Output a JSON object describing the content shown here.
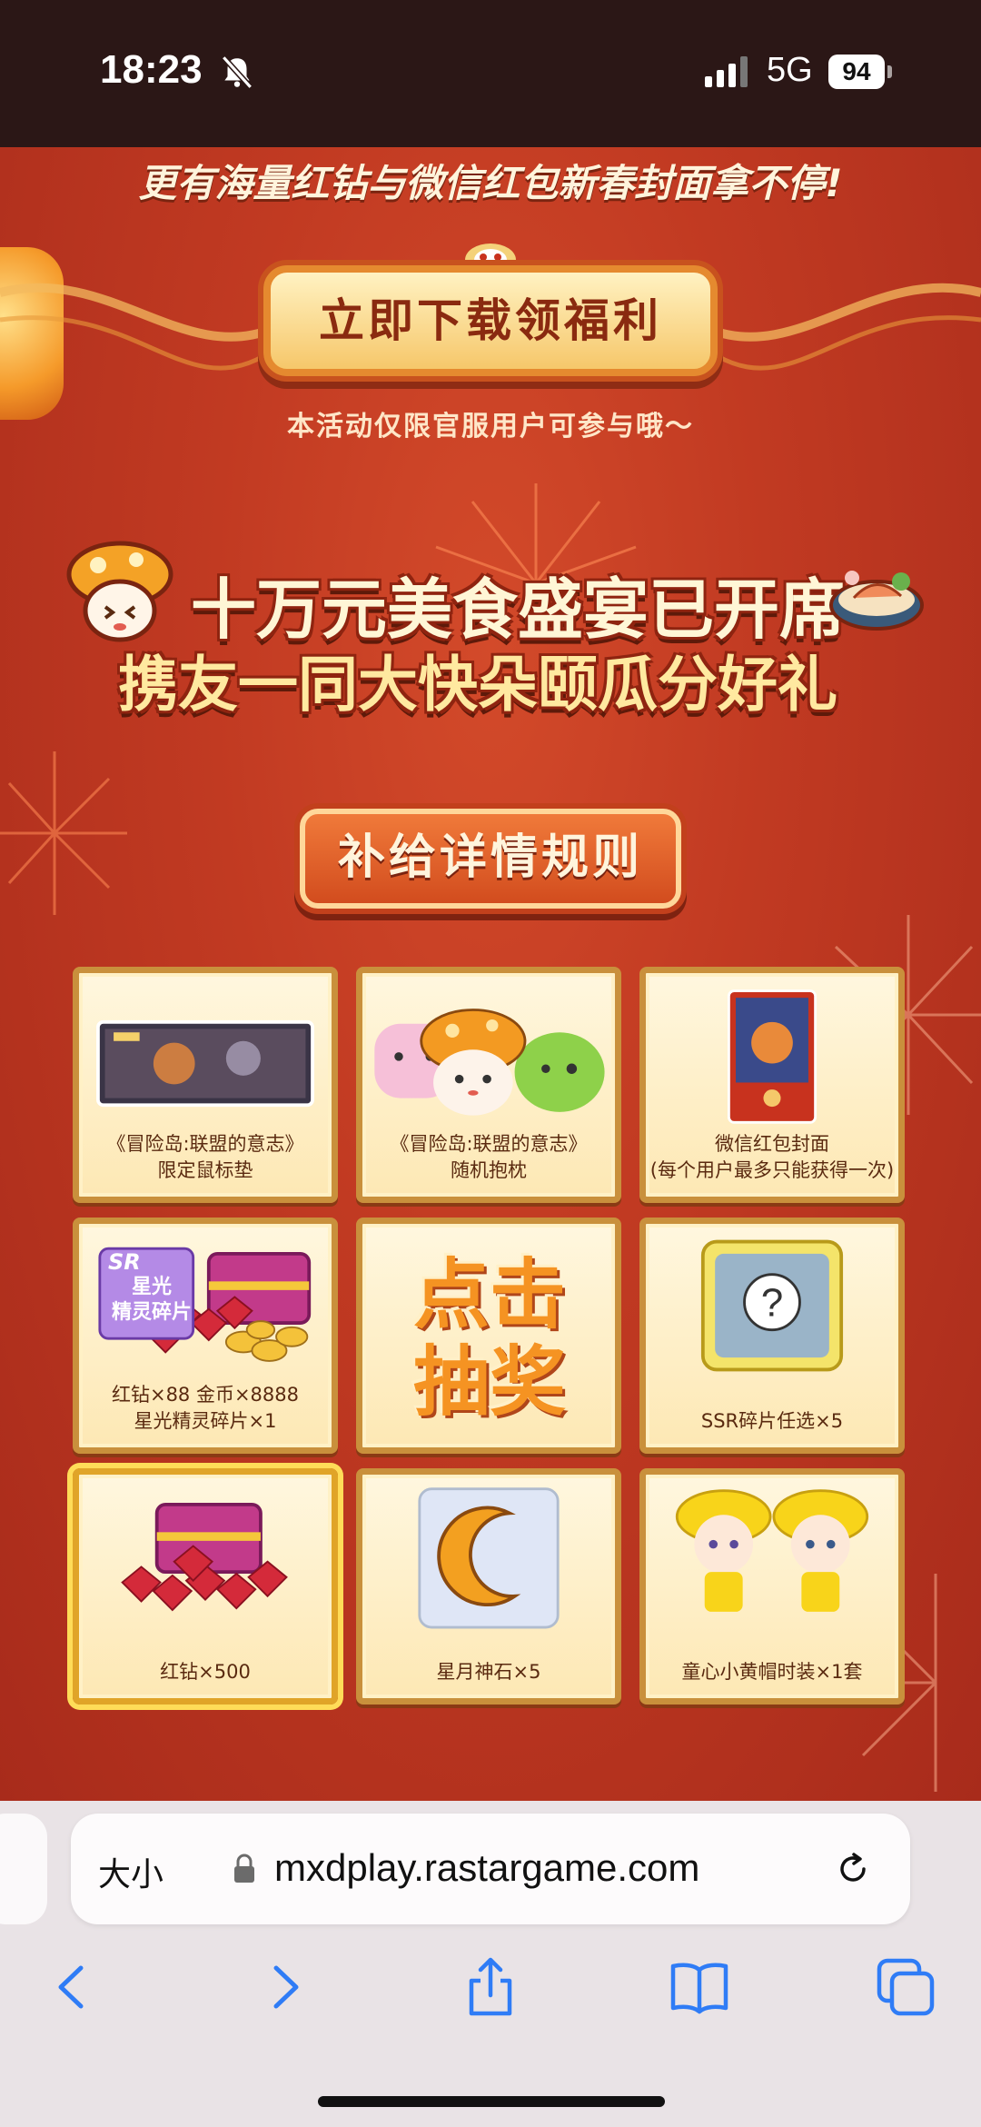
{
  "status_bar": {
    "time": "18:23",
    "network": "5G",
    "battery": "94"
  },
  "page": {
    "promo_text": "更有海量红钻与微信红包新春封面拿不停!",
    "download_button": "立即下载领福利",
    "notice": "本活动仅限官服用户可参与哦～",
    "headline_line1": "十万元美食盛宴已开席",
    "headline_line2": "携友一同大快朵颐瓜分好礼",
    "rules_button": "补给详情规则",
    "prizes": [
      {
        "label": "《冒险岛:联盟的意志》\n限定鼠标垫",
        "icon": "mousepad-icon"
      },
      {
        "label": "《冒险岛:联盟的意志》\n随机抱枕",
        "icon": "pillow-icon"
      },
      {
        "label": "微信红包封面\n(每个用户最多只能获得一次)",
        "icon": "red-envelope-icon"
      },
      {
        "label": "红钻×88  金币×8888\n星光精灵碎片×1",
        "icon": "treasure-chest-icon",
        "badge_top": "SR",
        "badge": "星光\n精灵碎片"
      },
      {
        "label": "点击\n抽奖",
        "icon": "draw-button"
      },
      {
        "label": "SSR碎片任选×5",
        "icon": "puzzle-piece-icon"
      },
      {
        "label": "红钻×500",
        "icon": "red-diamond-chest-icon"
      },
      {
        "label": "星月神石×5",
        "icon": "crescent-moon-icon"
      },
      {
        "label": "童心小黄帽时装×1套",
        "icon": "yellow-hat-outfit-icon"
      }
    ]
  },
  "browser": {
    "text_size": "大小",
    "url": "mxdplay.rastargame.com"
  },
  "colors": {
    "background_red": "#c13a22",
    "gold_border": "#c9903c",
    "cream": "#fff7df",
    "selected_highlight": "#ffdc58"
  }
}
